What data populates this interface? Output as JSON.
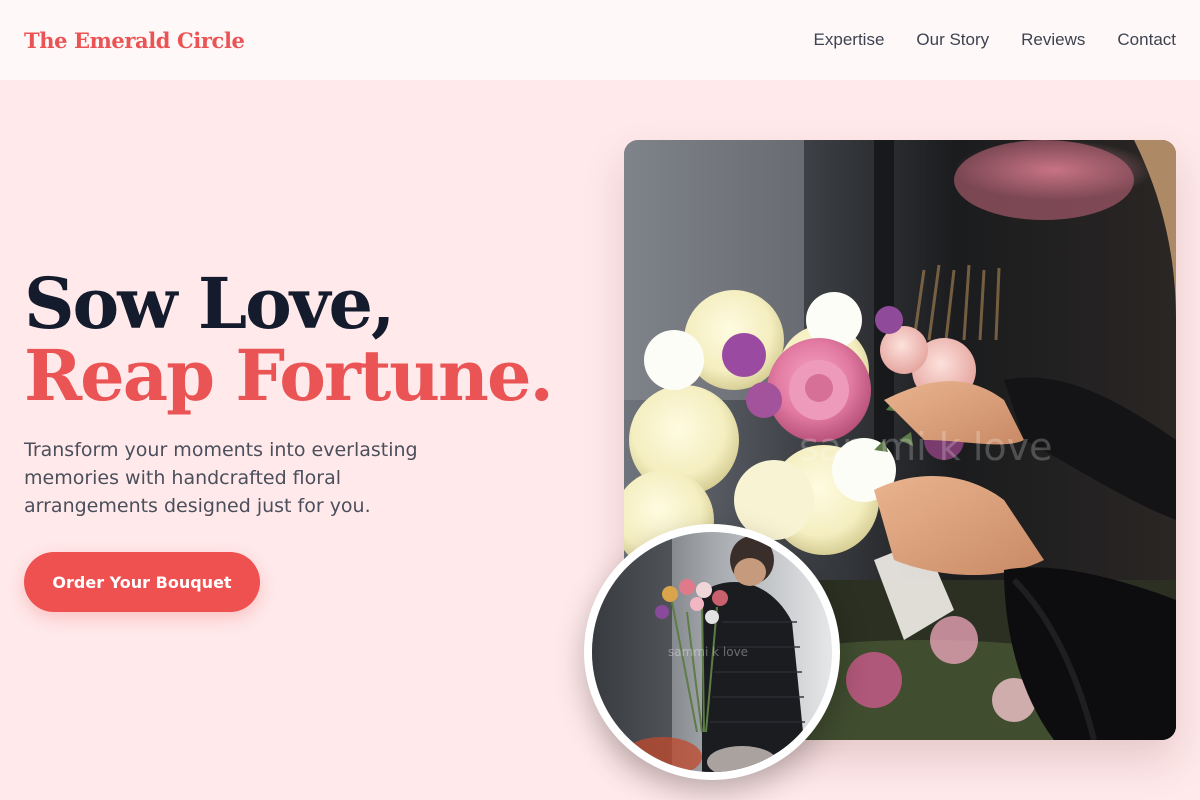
{
  "header": {
    "brand": "The Emerald Circle",
    "nav": [
      "Expertise",
      "Our Story",
      "Reviews",
      "Contact"
    ]
  },
  "hero": {
    "title_line1": "Sow Love,",
    "title_line2": "Reap Fortune.",
    "subtitle": "Transform your moments into everlasting memories with handcrafted floral arrangements designed just for you.",
    "cta_label": "Order Your Bouquet"
  },
  "images": {
    "main_watermark": "sammi k love",
    "inset_watermark": "sammi k love"
  },
  "colors": {
    "background": "#ffe9ea",
    "header_bg": "#fff8f8",
    "accent": "#ea5455",
    "title_dark": "#141b2c",
    "body_text": "#4a4f5b"
  }
}
